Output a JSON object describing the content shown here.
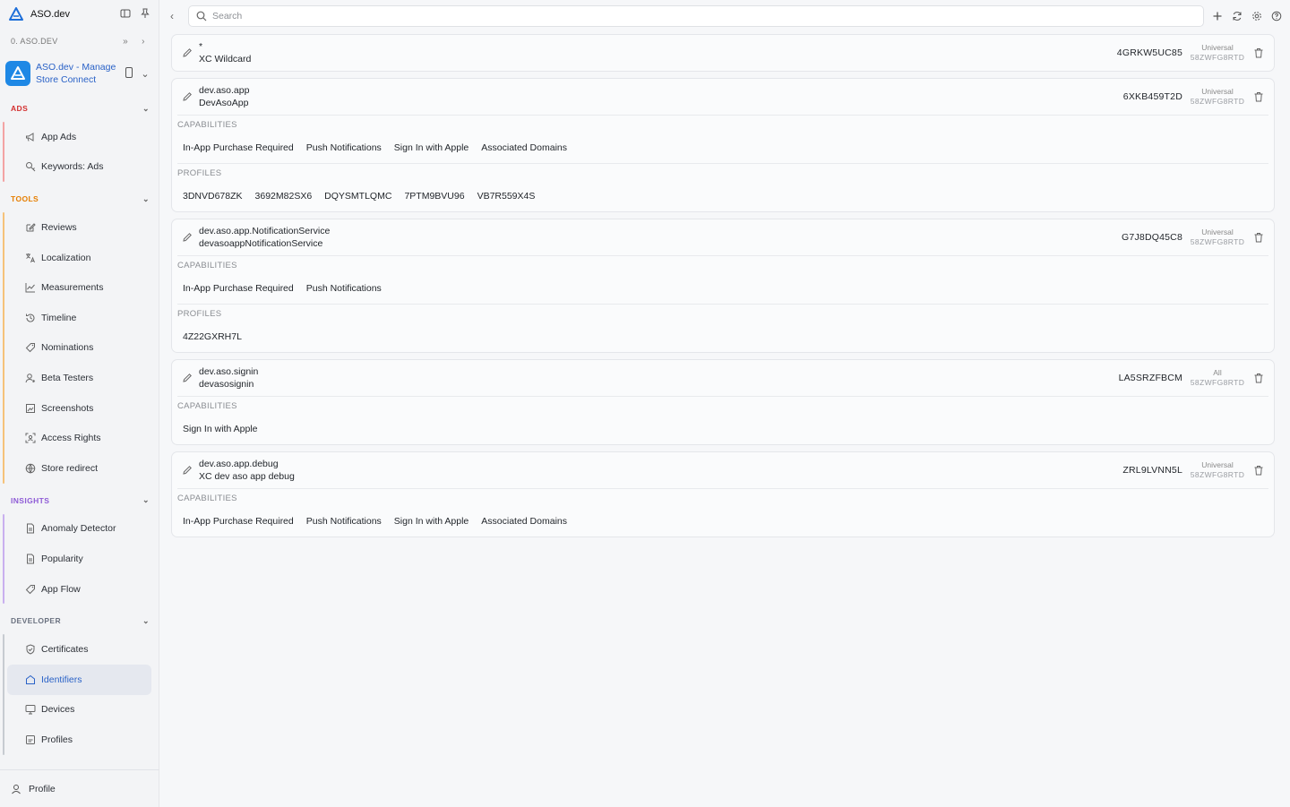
{
  "sidebar": {
    "brand": "ASO.dev",
    "org": "0. ASO.DEV",
    "app_name_line1": "ASO.dev - Manage",
    "app_name_line2": "Store Connect",
    "sections": {
      "ads": "ADS",
      "tools": "TOOLS",
      "insights": "INSIGHTS",
      "developer": "DEVELOPER"
    },
    "ads_items": [
      "App Ads",
      "Keywords: Ads"
    ],
    "tools_items": [
      "Reviews",
      "Localization",
      "Measurements",
      "Timeline",
      "Nominations",
      "Beta Testers",
      "Screenshots",
      "Access Rights",
      "Store redirect"
    ],
    "insights_items": [
      "Anomaly Detector",
      "Popularity",
      "App Flow"
    ],
    "developer_items": [
      "Certificates",
      "Identifiers",
      "Devices",
      "Profiles"
    ],
    "active_item": "Identifiers",
    "footer": "Profile"
  },
  "search": {
    "placeholder": "Search"
  },
  "labels": {
    "capabilities": "CAPABILITIES",
    "profiles": "PROFILES"
  },
  "identifiers": [
    {
      "bundle": "*",
      "name": "XC Wildcard",
      "code": "4GRKW5UC85",
      "platform": "Universal",
      "team": "58ZWFG8RTD",
      "capabilities": [],
      "profiles": []
    },
    {
      "bundle": "dev.aso.app",
      "name": "DevAsoApp",
      "code": "6XKB459T2D",
      "platform": "Universal",
      "team": "58ZWFG8RTD",
      "capabilities": [
        "In-App Purchase Required",
        "Push Notifications",
        "Sign In with Apple",
        "Associated Domains"
      ],
      "profiles": [
        "3DNVD678ZK",
        "3692M82SX6",
        "DQYSMTLQMC",
        "7PTM9BVU96",
        "VB7R559X4S"
      ]
    },
    {
      "bundle": "dev.aso.app.NotificationService",
      "name": "devasoappNotificationService",
      "code": "G7J8DQ45C8",
      "platform": "Universal",
      "team": "58ZWFG8RTD",
      "capabilities": [
        "In-App Purchase Required",
        "Push Notifications"
      ],
      "profiles": [
        "4Z22GXRH7L"
      ]
    },
    {
      "bundle": "dev.aso.signin",
      "name": "devasosignin",
      "code": "LA5SRZFBCM",
      "platform": "All",
      "team": "58ZWFG8RTD",
      "capabilities": [
        "Sign In with Apple"
      ],
      "profiles": []
    },
    {
      "bundle": "dev.aso.app.debug",
      "name": "XC dev aso app debug",
      "code": "ZRL9LVNN5L",
      "platform": "Universal",
      "team": "58ZWFG8RTD",
      "capabilities": [
        "In-App Purchase Required",
        "Push Notifications",
        "Sign In with Apple",
        "Associated Domains"
      ],
      "profiles": []
    }
  ]
}
